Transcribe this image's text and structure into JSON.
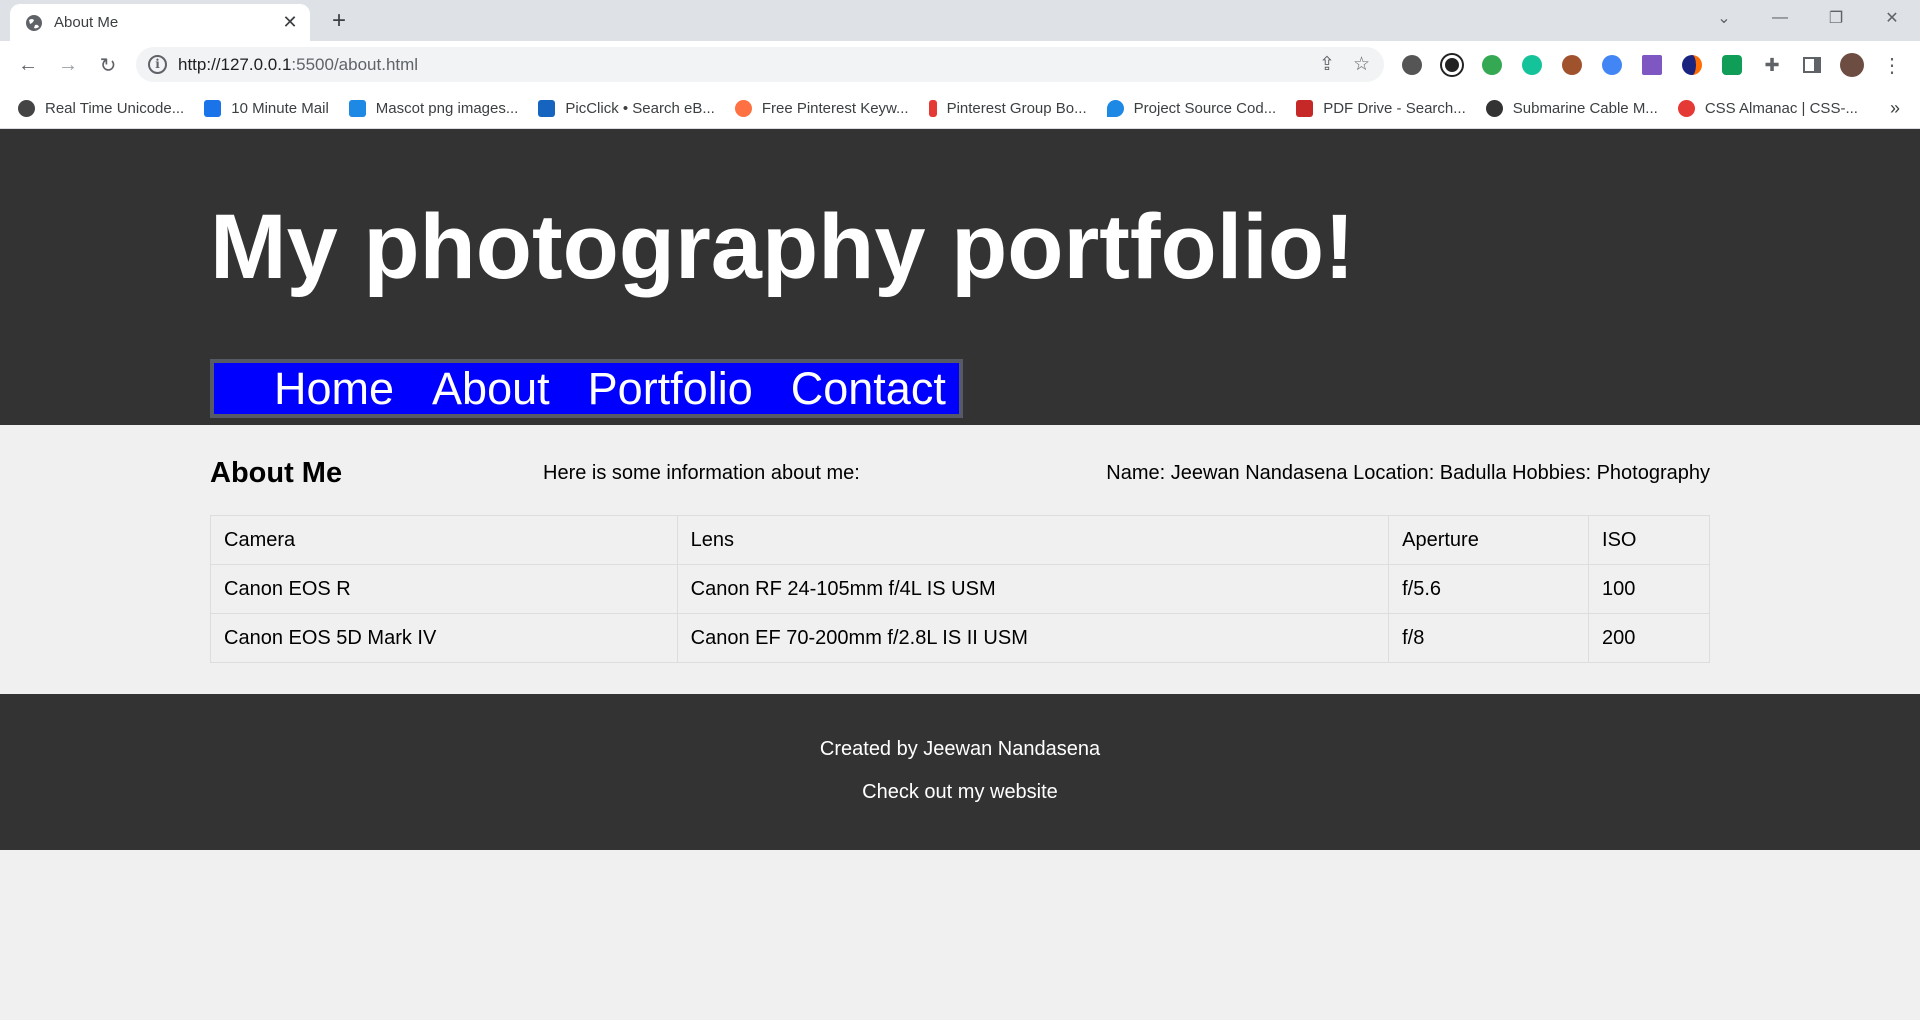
{
  "browser": {
    "tab_title": "About Me",
    "tab_close": "✕",
    "new_tab": "+",
    "url_host": "http://127.0.0.1",
    "url_path": ":5500/about.html",
    "bookmarks": [
      {
        "label": "Real Time Unicode...",
        "color": "#444444"
      },
      {
        "label": "10 Minute Mail",
        "color": "#1a73e8"
      },
      {
        "label": "Mascot png images...",
        "color": "#1e88e5"
      },
      {
        "label": "PicClick • Search eB...",
        "color": "#1565c0"
      },
      {
        "label": "Free Pinterest Keyw...",
        "color": "#ff7043"
      },
      {
        "label": "Pinterest Group Bo...",
        "color": "#e53935"
      },
      {
        "label": "Project Source Cod...",
        "color": "#1e88e5"
      },
      {
        "label": "PDF Drive - Search...",
        "color": "#c62828"
      },
      {
        "label": "Submarine Cable M...",
        "color": "#333333"
      },
      {
        "label": "CSS Almanac | CSS-...",
        "color": "#e53935"
      }
    ],
    "bookmarks_more": "»"
  },
  "site": {
    "title": "My photography portfolio!",
    "nav": [
      "Home",
      "About",
      "Portfolio",
      "Contact"
    ]
  },
  "about": {
    "heading": "About Me",
    "intro": "Here is some information about me:",
    "details": "Name: Jeewan Nandasena Location: Badulla Hobbies: Photography"
  },
  "gear_table": {
    "headers": [
      "Camera",
      "Lens",
      "Aperture",
      "ISO"
    ],
    "rows": [
      [
        "Canon EOS R",
        "Canon RF 24-105mm f/4L IS USM",
        "f/5.6",
        "100"
      ],
      [
        "Canon EOS 5D Mark IV",
        "Canon EF 70-200mm f/2.8L IS II USM",
        "f/8",
        "200"
      ]
    ]
  },
  "footer": {
    "credit": "Created by Jeewan Nandasena",
    "website": "Check out my website"
  },
  "colors": {
    "header_bg": "#333333",
    "nav_bg": "#0000ff",
    "page_bg": "#f0f0f0"
  }
}
